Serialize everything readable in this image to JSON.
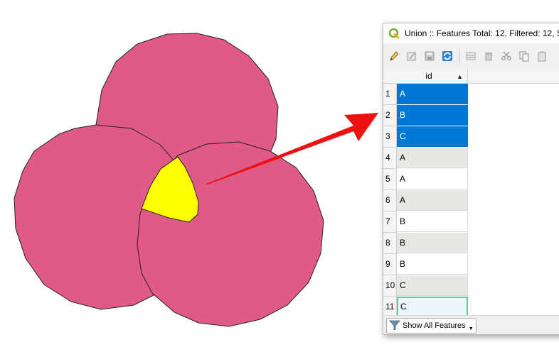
{
  "window": {
    "title": "Union :: Features Total: 12, Filtered: 12, S"
  },
  "table": {
    "column_header": "id",
    "rows": [
      {
        "num": "1",
        "id": "A",
        "state": "selected"
      },
      {
        "num": "2",
        "id": "B",
        "state": "selected"
      },
      {
        "num": "3",
        "id": "C",
        "state": "selected"
      },
      {
        "num": "4",
        "id": "A",
        "state": "alt"
      },
      {
        "num": "5",
        "id": "A",
        "state": "plain"
      },
      {
        "num": "6",
        "id": "A",
        "state": "alt"
      },
      {
        "num": "7",
        "id": "B",
        "state": "plain"
      },
      {
        "num": "8",
        "id": "B",
        "state": "alt"
      },
      {
        "num": "9",
        "id": "B",
        "state": "plain"
      },
      {
        "num": "10",
        "id": "C",
        "state": "alt"
      },
      {
        "num": "11",
        "id": "C",
        "state": "focus"
      }
    ]
  },
  "footer": {
    "filter_label": "Show All Features"
  },
  "colors": {
    "polygon_fill": "#e05a87",
    "intersection_fill": "#ffff00",
    "arrow": "#ee1111",
    "selection": "#0078d7"
  },
  "icons": {
    "app": "qgis-logo-icon",
    "toolbar": [
      "pencil-icon",
      "multi-edit-icon",
      "save-icon",
      "refresh-icon",
      "add-feature-icon",
      "delete-icon",
      "cut-icon",
      "copy-icon",
      "paste-icon"
    ],
    "filter": "filter-funnel-icon"
  }
}
